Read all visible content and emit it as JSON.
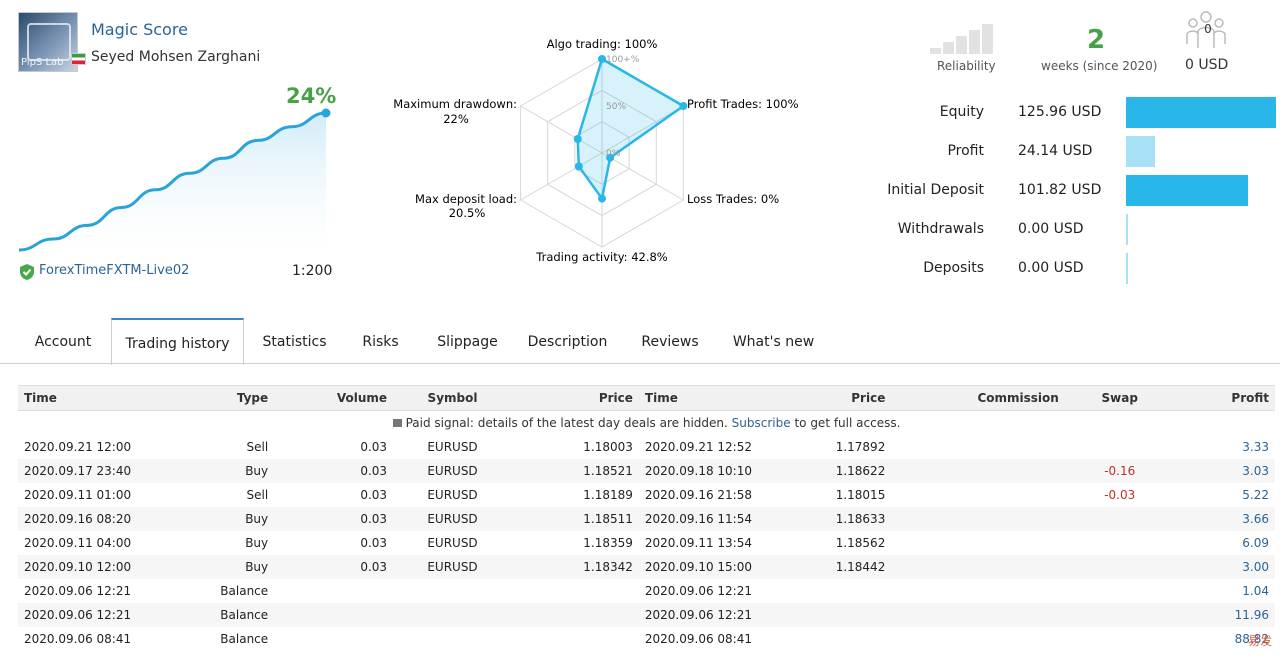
{
  "profile": {
    "avatar_text": "PipS Lab",
    "signal_name": "Magic Score",
    "author": "Seyed Mohsen Zarghani",
    "growth": "24%",
    "broker": "ForexTimeFXTM-Live02",
    "leverage": "1:200"
  },
  "growth_curve": [
    0,
    8,
    18,
    31,
    44,
    56,
    67,
    80,
    90,
    100
  ],
  "radar": {
    "ticks": [
      "100+%",
      "50%",
      "0%"
    ],
    "axes": [
      {
        "label": "Algo trading: 100%",
        "value": 100
      },
      {
        "label": "Profit Trades: 100%",
        "value": 100
      },
      {
        "label": "Loss Trades: 0%",
        "value": 0
      },
      {
        "label": "Trading activity: 42.8%",
        "value": 42.8
      },
      {
        "label_line1": "Max deposit load:",
        "label_line2": "20.5%",
        "value": 20.5
      },
      {
        "label_line1": "Maximum drawdown:",
        "label_line2": "22%",
        "value": 22
      }
    ]
  },
  "summary": {
    "reliability_label": "Reliability",
    "weeks_value": "2",
    "weeks_label": "weeks (since 2020)",
    "subscribers_count": "0",
    "subscribers_usd": "0 USD"
  },
  "stats": [
    {
      "label": "Equity",
      "value": "125.96 USD",
      "fraction": 1.0,
      "color": "#29b6e8"
    },
    {
      "label": "Profit",
      "value": "24.14 USD",
      "fraction": 0.19,
      "color": "#a8e0f5"
    },
    {
      "label": "Initial Deposit",
      "value": "101.82 USD",
      "fraction": 0.81,
      "color": "#29b6e8"
    },
    {
      "label": "Withdrawals",
      "value": "0.00 USD",
      "fraction": 0.0,
      "color": "#a8e0f5"
    },
    {
      "label": "Deposits",
      "value": "0.00 USD",
      "fraction": 0.0,
      "color": "#a8e0f5"
    }
  ],
  "tabs": [
    "Account",
    "Trading history",
    "Statistics",
    "Risks",
    "Slippage",
    "Description",
    "Reviews",
    "What's new"
  ],
  "active_tab": 1,
  "table": {
    "headers": [
      "Time",
      "Type",
      "Volume",
      "Symbol",
      "Price",
      "Time",
      "Price",
      "Commission",
      "Swap",
      "Profit"
    ],
    "notice_pre": "Paid signal: details of the latest day deals are hidden.",
    "notice_link": "Subscribe",
    "notice_post": "to get full access.",
    "rows": [
      [
        "2020.09.21 12:00",
        "Sell",
        "0.03",
        "EURUSD",
        "1.18003",
        "2020.09.21 12:52",
        "1.17892",
        "",
        "",
        "3.33"
      ],
      [
        "2020.09.17 23:40",
        "Buy",
        "0.03",
        "EURUSD",
        "1.18521",
        "2020.09.18 10:10",
        "1.18622",
        "",
        "-0.16",
        "3.03"
      ],
      [
        "2020.09.11 01:00",
        "Sell",
        "0.03",
        "EURUSD",
        "1.18189",
        "2020.09.16 21:58",
        "1.18015",
        "",
        "-0.03",
        "5.22"
      ],
      [
        "2020.09.16 08:20",
        "Buy",
        "0.03",
        "EURUSD",
        "1.18511",
        "2020.09.16 11:54",
        "1.18633",
        "",
        "",
        "3.66"
      ],
      [
        "2020.09.11 04:00",
        "Buy",
        "0.03",
        "EURUSD",
        "1.18359",
        "2020.09.11 13:54",
        "1.18562",
        "",
        "",
        "6.09"
      ],
      [
        "2020.09.10 12:00",
        "Buy",
        "0.03",
        "EURUSD",
        "1.18342",
        "2020.09.10 15:00",
        "1.18442",
        "",
        "",
        "3.00"
      ],
      [
        "2020.09.06 12:21",
        "Balance",
        "",
        "",
        "",
        "2020.09.06 12:21",
        "",
        "",
        "",
        "1.04"
      ],
      [
        "2020.09.06 12:21",
        "Balance",
        "",
        "",
        "",
        "2020.09.06 12:21",
        "",
        "",
        "",
        "11.96"
      ],
      [
        "2020.09.06 08:41",
        "Balance",
        "",
        "",
        "",
        "2020.09.06 08:41",
        "",
        "",
        "",
        "88.82"
      ]
    ]
  },
  "watermark": "易发"
}
